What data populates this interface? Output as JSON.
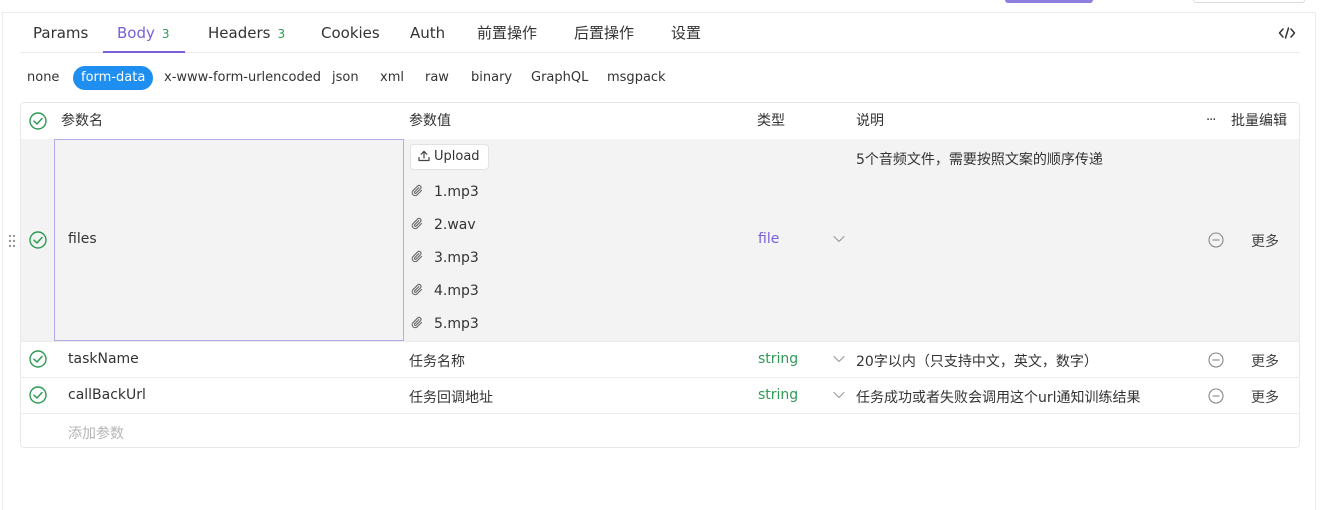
{
  "tabs": [
    {
      "label": "Params",
      "badge": ""
    },
    {
      "label": "Body",
      "badge": "3"
    },
    {
      "label": "Headers",
      "badge": "3"
    },
    {
      "label": "Cookies",
      "badge": ""
    },
    {
      "label": "Auth",
      "badge": ""
    },
    {
      "label": "前置操作",
      "badge": ""
    },
    {
      "label": "后置操作",
      "badge": ""
    },
    {
      "label": "设置",
      "badge": ""
    }
  ],
  "active_tab": "Body",
  "body_types": [
    "none",
    "form-data",
    "x-www-form-urlencoded",
    "json",
    "xml",
    "raw",
    "binary",
    "GraphQL",
    "msgpack"
  ],
  "active_body_type": "form-data",
  "table": {
    "headers": {
      "name": "参数名",
      "value": "参数值",
      "type": "类型",
      "desc": "说明",
      "ellipsis": "···",
      "bulk_edit": "批量编辑"
    },
    "rows": [
      {
        "name": "files",
        "upload_label": "Upload",
        "files": [
          "1.mp3",
          "2.wav",
          "3.mp3",
          "4.mp3",
          "5.mp3"
        ],
        "type": "file",
        "desc": "5个音频文件，需要按照文案的顺序传递",
        "more": "更多"
      },
      {
        "name": "taskName",
        "value": "任务名称",
        "type": "string",
        "desc": "20字以内（只支持中文，英文，数字）",
        "more": "更多"
      },
      {
        "name": "callBackUrl",
        "value": "任务回调地址",
        "type": "string",
        "desc": "任务成功或者失败会调用这个url通知训练结果",
        "more": "更多"
      }
    ],
    "add_placeholder": "添加参数"
  },
  "colors": {
    "accent": "#7a5fd9",
    "badge": "#2e9a55",
    "active_pill": "#1e8ff0",
    "check": "#2e9a55",
    "type_file": "#7a5fd9",
    "type_string": "#2e9a55"
  }
}
